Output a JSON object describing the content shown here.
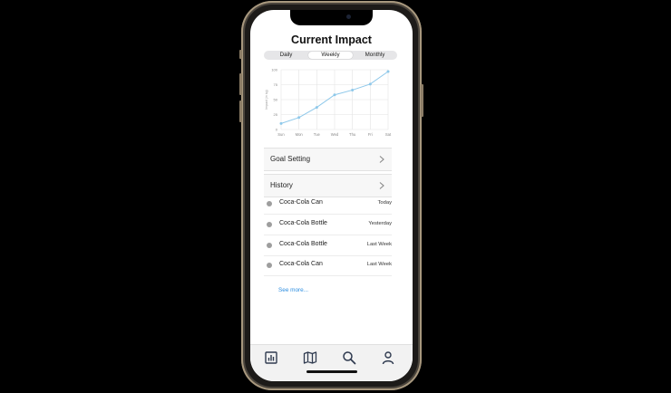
{
  "screen": {
    "title": "Current Impact"
  },
  "segments": [
    "Daily",
    "Weekly",
    "Monthly"
  ],
  "selected_segment": "Weekly",
  "chart_data": {
    "type": "line",
    "categories": [
      "Sun",
      "Mon",
      "Tue",
      "Wed",
      "Thu",
      "Fri",
      "Sat"
    ],
    "values": [
      10,
      20,
      37,
      58,
      66,
      76,
      97
    ],
    "ylabel": "Impact (in kg)",
    "yticks": [
      0,
      25,
      50,
      75,
      100
    ],
    "ylim": [
      0,
      100
    ],
    "grid": true,
    "color": "#8ec8ea"
  },
  "menu": {
    "goal_setting": "Goal Setting",
    "history": "History"
  },
  "history_items": [
    {
      "name": "Coca-Cola Can",
      "time": "Today"
    },
    {
      "name": "Coca-Cola Bottle",
      "time": "Yesterday"
    },
    {
      "name": "Coca-Cola Bottle",
      "time": "Last Week"
    },
    {
      "name": "Coca-Cola Can",
      "time": "Last Week"
    }
  ],
  "see_more": "See more...",
  "tabbar": [
    "bar-chart-icon",
    "map-icon",
    "search-icon",
    "profile-icon"
  ],
  "colors": {
    "accent": "#2b8de0",
    "icon": "#2f3a4f"
  }
}
